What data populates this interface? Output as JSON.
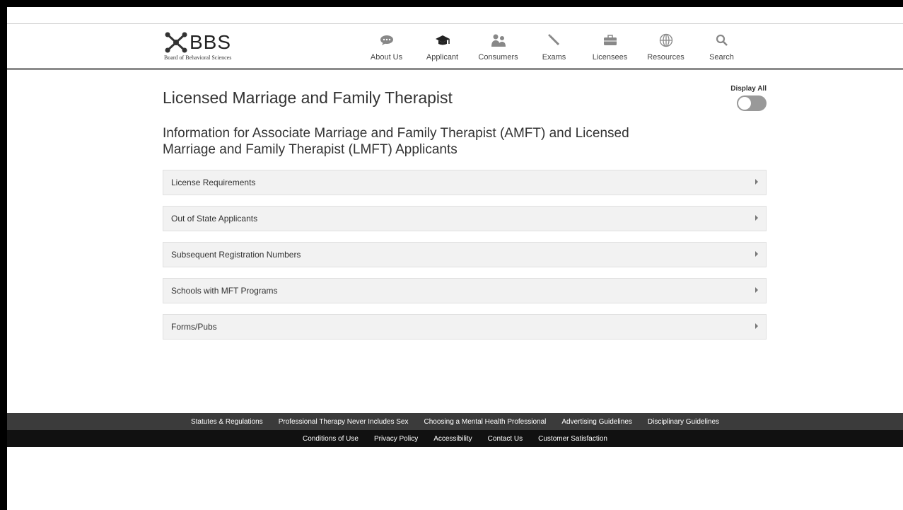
{
  "header": {
    "logo_text": "BBS",
    "logo_subtitle": "Board of Behavioral Sciences",
    "nav": [
      {
        "label": "About Us",
        "icon": "speech-bubble-icon"
      },
      {
        "label": "Applicant",
        "icon": "graduation-cap-icon"
      },
      {
        "label": "Consumers",
        "icon": "people-icon"
      },
      {
        "label": "Exams",
        "icon": "pencil-icon"
      },
      {
        "label": "Licensees",
        "icon": "briefcase-icon"
      },
      {
        "label": "Resources",
        "icon": "globe-icon"
      },
      {
        "label": "Search",
        "icon": "search-icon"
      }
    ]
  },
  "main": {
    "title": "Licensed Marriage and Family Therapist",
    "display_all_label": "Display All",
    "display_all_on": false,
    "subtitle": "Information for Associate Marriage and Family Therapist (AMFT) and Licensed Marriage and Family Therapist (LMFT) Applicants",
    "accordion": [
      {
        "label": "License Requirements"
      },
      {
        "label": "Out of State Applicants"
      },
      {
        "label": "Subsequent Registration Numbers"
      },
      {
        "label": "Schools with MFT Programs"
      },
      {
        "label": "Forms/Pubs"
      }
    ]
  },
  "footer": {
    "row1": [
      "Statutes & Regulations",
      "Professional Therapy Never Includes Sex",
      "Choosing a Mental Health Professional",
      "Advertising Guidelines",
      "Disciplinary Guidelines"
    ],
    "row2": [
      "Conditions of Use",
      "Privacy Policy",
      "Accessibility",
      "Contact Us",
      "Customer Satisfaction"
    ]
  },
  "colors": {
    "footer_top": "#3b3b3b",
    "footer_bottom": "#111111",
    "accordion_bg": "#f2f2f2",
    "header_rule": "#8c8c8c"
  }
}
